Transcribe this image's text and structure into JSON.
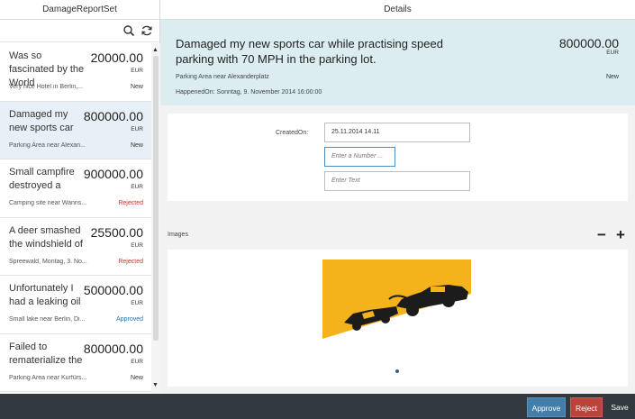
{
  "master": {
    "title": "DamageReportSet",
    "items": [
      {
        "title": "Was so fascinated by the World",
        "amount": "20000.00",
        "currency": "EUR",
        "location": "Very nice Hotel in Berlin,...",
        "status": "New",
        "status_color": "#333333"
      },
      {
        "title": "Damaged my new sports car",
        "amount": "800000.00",
        "currency": "EUR",
        "location": "Parking Area near Alexan...",
        "status": "New",
        "status_color": "#333333"
      },
      {
        "title": "Small campfire destroyed a",
        "amount": "900000.00",
        "currency": "EUR",
        "location": "Camping site near Wanns...",
        "status": "Rejected",
        "status_color": "#c0392b"
      },
      {
        "title": "A deer smashed the windshield of",
        "amount": "25500.00",
        "currency": "EUR",
        "location": "Spreewald, Montag, 3. No...",
        "status": "Rejected",
        "status_color": "#c0392b"
      },
      {
        "title": "Unfortunately I had a leaking oil",
        "amount": "500000.00",
        "currency": "EUR",
        "location": "Small lake near Berlin, Di...",
        "status": "Approved",
        "status_color": "#2b6ea4"
      },
      {
        "title": "Failed to rematerialize the",
        "amount": "800000.00",
        "currency": "EUR",
        "location": "Parking Area near Kurfürs...",
        "status": "New",
        "status_color": "#333333"
      }
    ]
  },
  "detail": {
    "title": "Details",
    "header": {
      "title": "Damaged my new sports car while practising speed parking with 70 MPH in the parking lot.",
      "number": "800000.00",
      "unit": "EUR",
      "location": "Parking Area near Alexanderplatz",
      "status": "New",
      "happened_on": "HappenedOn: Sonntag, 9. November 2014 16:00:00"
    },
    "form": {
      "created_on_label": "CreatedOn:",
      "created_on_value": "25.11.2014 14.11",
      "number_placeholder": "Enter a Number ...",
      "text_placeholder": "Enter Text"
    },
    "images": {
      "label": "Images",
      "remove_label": "−",
      "add_label": "+"
    }
  },
  "footer": {
    "approve": "Approve",
    "reject": "Reject",
    "save": "Save"
  },
  "colors": {
    "header_bg": "#dcedf1",
    "selected_item_bg": "#e6f0f6",
    "approve": "#437eaa",
    "reject": "#b9443c",
    "footer_bg": "#333a3f"
  }
}
